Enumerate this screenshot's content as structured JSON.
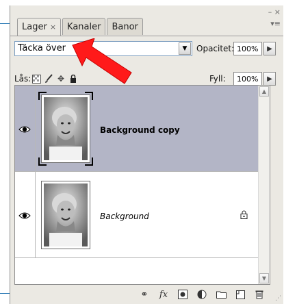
{
  "panel": {
    "tabs": [
      {
        "label": "Lager",
        "close": "×",
        "active": true
      },
      {
        "label": "Kanaler",
        "active": false
      },
      {
        "label": "Banor",
        "active": false
      }
    ],
    "collapse_glyph": "– ×",
    "menu_glyph": "▾≡"
  },
  "blend_mode": {
    "value": "Täcka över"
  },
  "opacity": {
    "label": "Opacitet:",
    "value": "100%"
  },
  "lock": {
    "label": "Lås:"
  },
  "fill": {
    "label": "Fyll:",
    "value": "100%"
  },
  "layers": [
    {
      "name": "Background copy",
      "selected": true,
      "visible": true,
      "locked": false
    },
    {
      "name": "Background",
      "selected": false,
      "visible": true,
      "locked": true
    }
  ],
  "icons": {
    "lock_transparency": "transparency-lock-icon",
    "lock_pixels": "brush-lock-icon",
    "lock_position": "move-lock-icon",
    "lock_all": "lock-all-icon",
    "bottom": [
      "link-layers-icon",
      "fx-icon",
      "mask-icon",
      "adjustment-icon",
      "folder-icon",
      "new-layer-icon",
      "trash-icon"
    ]
  },
  "colors": {
    "selected_row": "#b3b5c6",
    "annotation_arrow": "#ff1a1a",
    "guide_line": "#1a6fb0"
  }
}
